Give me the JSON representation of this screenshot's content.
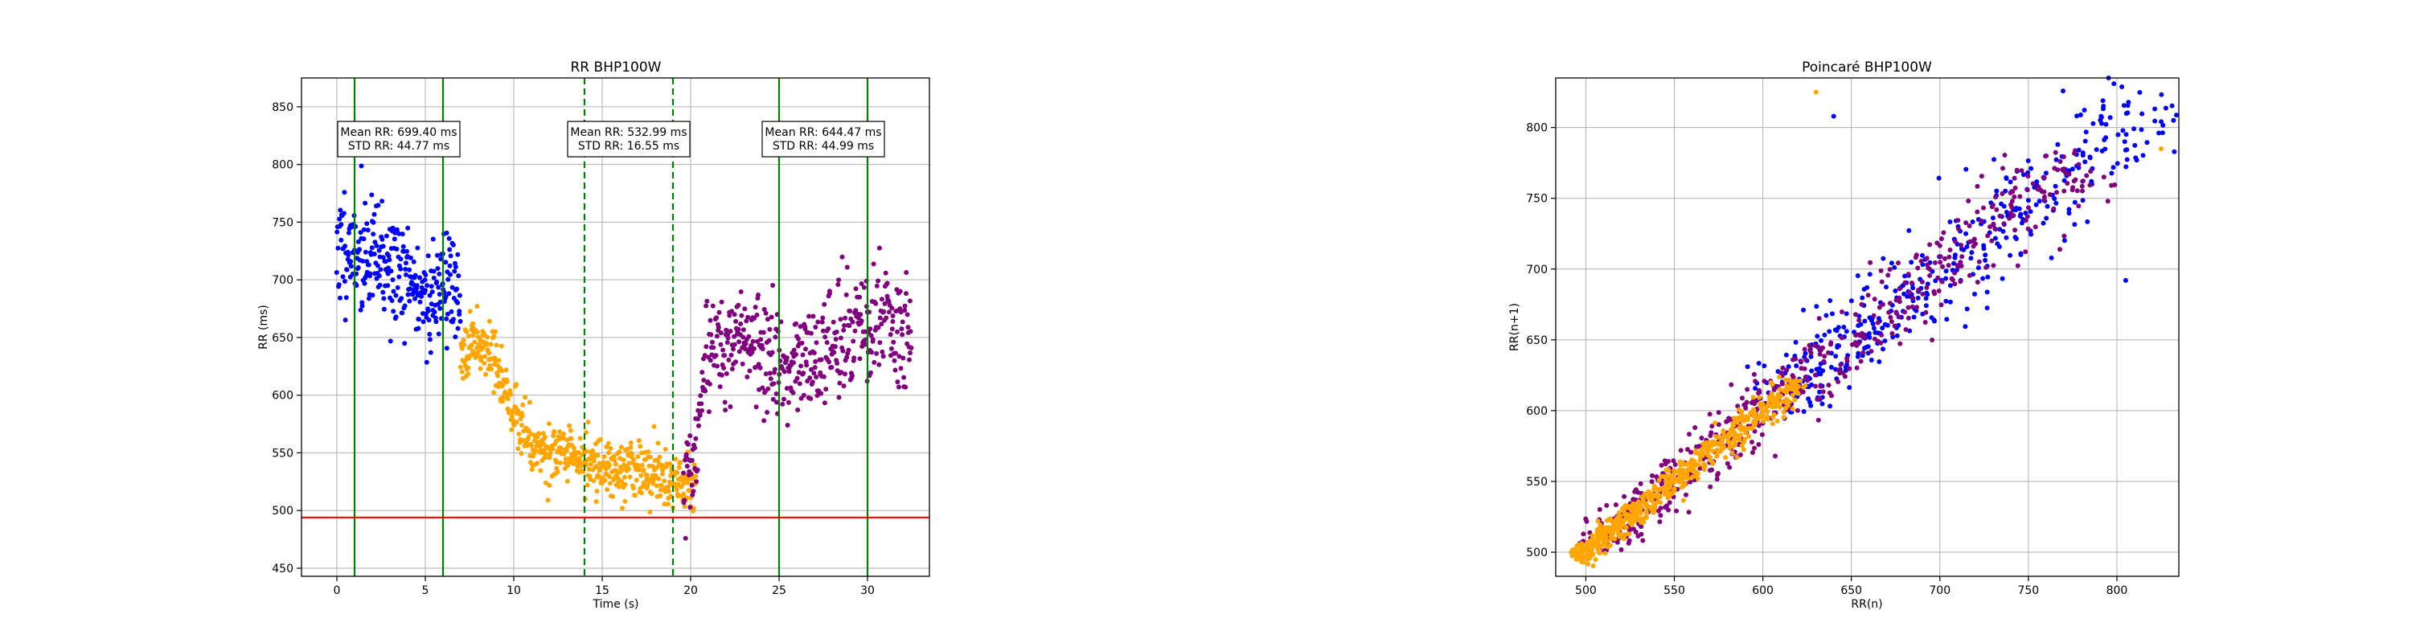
{
  "chart_data": [
    {
      "type": "scatter",
      "title": "RR BHP100W",
      "xlabel": "Time (s)",
      "ylabel": "RR (ms)",
      "xlim": [
        -2,
        33.5
      ],
      "ylim": [
        443,
        875
      ],
      "xticks": [
        0,
        5,
        10,
        15,
        20,
        25,
        30
      ],
      "yticks": [
        450,
        500,
        550,
        600,
        650,
        700,
        750,
        800,
        850
      ],
      "grid": true,
      "segment_colors": {
        "rest": "#0000ff",
        "exercise": "#ffa500",
        "recovery": "#800080"
      },
      "series": [
        {
          "segment": "rest",
          "x_range": [
            0,
            7
          ],
          "trend": [
            [
              0,
              730
            ],
            [
              2,
              720
            ],
            [
              4,
              700
            ],
            [
              5.2,
              680
            ],
            [
              6,
              700
            ],
            [
              7,
              690
            ]
          ],
          "spread": 45,
          "n": 300,
          "seed": 11
        },
        {
          "segment": "exercise",
          "x_range": [
            7,
            20.3
          ],
          "trend": [
            [
              7,
              640
            ],
            [
              8,
              650
            ],
            [
              8.6,
              640
            ],
            [
              10,
              585
            ],
            [
              11,
              560
            ],
            [
              13,
              545
            ],
            [
              16,
              538
            ],
            [
              19,
              528
            ],
            [
              20.3,
              520
            ]
          ],
          "spread": 22,
          "n": 560,
          "seed": 23
        },
        {
          "segment": "recovery",
          "x_range": [
            19.6,
            32.5
          ],
          "trend": [
            [
              19.6,
              520
            ],
            [
              20.3,
              540
            ],
            [
              21,
              640
            ],
            [
              23,
              650
            ],
            [
              25,
              620
            ],
            [
              27,
              630
            ],
            [
              29,
              655
            ],
            [
              31,
              665
            ],
            [
              32.5,
              650
            ]
          ],
          "spread": 42,
          "n": 480,
          "seed": 37
        }
      ],
      "vertical_lines": [
        {
          "x": 1,
          "style": "solid",
          "color": "#008000"
        },
        {
          "x": 6,
          "style": "solid",
          "color": "#008000"
        },
        {
          "x": 14,
          "style": "dashed",
          "color": "#008000"
        },
        {
          "x": 19,
          "style": "dashed",
          "color": "#008000"
        },
        {
          "x": 25,
          "style": "solid",
          "color": "#008000"
        },
        {
          "x": 30,
          "style": "solid",
          "color": "#008000"
        }
      ],
      "horizontal_lines": [
        {
          "y": 494,
          "color": "#ff0000"
        }
      ],
      "annotations": [
        {
          "x": 3.5,
          "y": 822,
          "lines": [
            "Mean RR: 699.40 ms",
            "STD RR: 44.77 ms"
          ]
        },
        {
          "x": 16.5,
          "y": 822,
          "lines": [
            "Mean RR: 532.99 ms",
            "STD RR: 16.55 ms"
          ]
        },
        {
          "x": 27.5,
          "y": 822,
          "lines": [
            "Mean RR: 644.47 ms",
            "STD RR: 44.99 ms"
          ]
        }
      ]
    },
    {
      "type": "scatter",
      "title": "Poincaré BHP100W",
      "xlabel": "RR(n)",
      "ylabel": "RR(n+1)",
      "xlim": [
        483,
        835
      ],
      "ylim": [
        483,
        835
      ],
      "xticks": [
        500,
        550,
        600,
        650,
        700,
        750,
        800
      ],
      "yticks": [
        500,
        550,
        600,
        650,
        700,
        750,
        800
      ],
      "grid": true,
      "segment_colors": {
        "rest": "#0000ff",
        "exercise": "#ffa500",
        "recovery": "#800080"
      },
      "series": [
        {
          "segment": "rest",
          "center_range": [
            605,
            825
          ],
          "spread": 28,
          "n": 420,
          "seed": 51
        },
        {
          "segment": "recovery",
          "center_range": [
            505,
            780
          ],
          "spread": 24,
          "n": 560,
          "seed": 63
        },
        {
          "segment": "exercise",
          "center_range": [
            495,
            620
          ],
          "spread": 12,
          "n": 620,
          "seed": 79
        }
      ],
      "outliers": [
        {
          "segment": "exercise",
          "x": 630,
          "y": 825
        },
        {
          "segment": "rest",
          "x": 640,
          "y": 808
        },
        {
          "segment": "exercise",
          "x": 825,
          "y": 785
        },
        {
          "segment": "rest",
          "x": 805,
          "y": 692
        }
      ]
    }
  ]
}
